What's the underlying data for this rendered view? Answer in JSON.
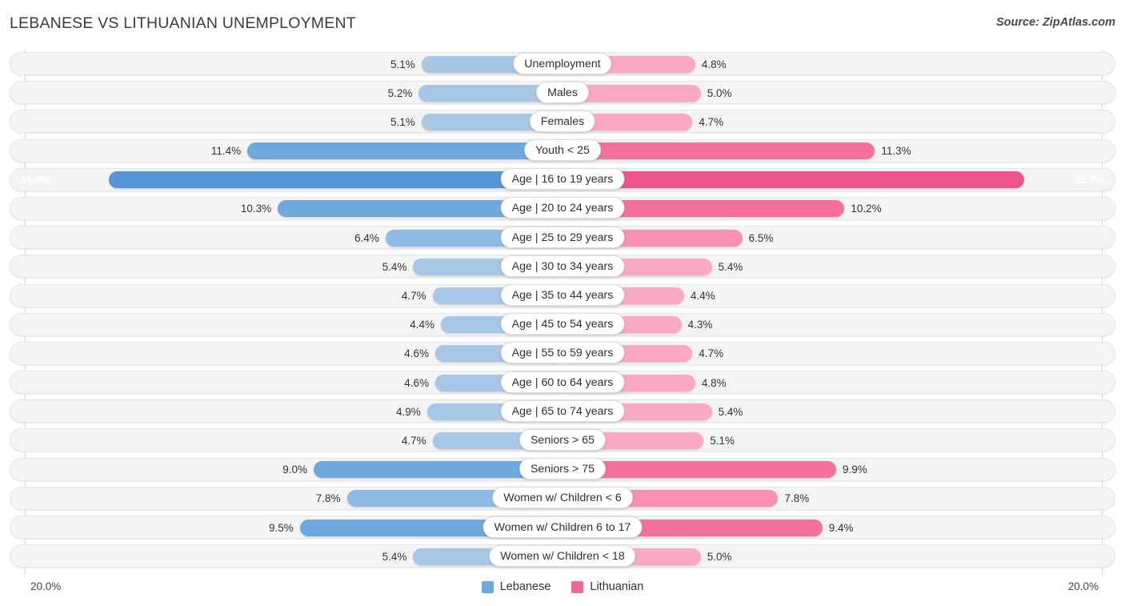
{
  "header": {
    "title": "LEBANESE VS LITHUANIAN UNEMPLOYMENT",
    "source": "Source: ZipAtlas.com"
  },
  "footer": {
    "axis_max_left": "20.0%",
    "axis_max_right": "20.0%"
  },
  "legend": {
    "items": [
      {
        "label": "Lebanese",
        "color": "#6fa8dc"
      },
      {
        "label": "Lithuanian",
        "color": "#f0679a"
      }
    ]
  },
  "colors": {
    "left_normal": "#a7c7e7",
    "left_mid": "#8fbae3",
    "left_strong": "#6fa8dc",
    "left_max": "#5596d8",
    "right_normal": "#fba8c5",
    "right_mid": "#f98fb5",
    "right_strong": "#f4719f",
    "right_max": "#f0538c",
    "track": "#f4f4f4",
    "axis": "#d8d8d8"
  },
  "chart_data": {
    "type": "bar",
    "subtype": "diverging-bidirectional-bar",
    "title": "LEBANESE VS LITHUANIAN UNEMPLOYMENT",
    "source": "Source: ZipAtlas.com",
    "xlabel": "",
    "ylabel": "",
    "xlim": [
      20.0,
      20.0
    ],
    "axis_max": 20.0,
    "unit": "%",
    "grid": false,
    "legend_position": "bottom-center",
    "categories": [
      "Unemployment",
      "Males",
      "Females",
      "Youth < 25",
      "Age | 16 to 19 years",
      "Age | 20 to 24 years",
      "Age | 25 to 29 years",
      "Age | 30 to 34 years",
      "Age | 35 to 44 years",
      "Age | 45 to 54 years",
      "Age | 55 to 59 years",
      "Age | 60 to 64 years",
      "Age | 65 to 74 years",
      "Seniors > 65",
      "Seniors > 75",
      "Women w/ Children < 6",
      "Women w/ Children 6 to 17",
      "Women w/ Children < 18"
    ],
    "series": [
      {
        "name": "Lebanese",
        "color": "#6fa8dc",
        "side": "left",
        "values": [
          5.1,
          5.2,
          5.1,
          11.4,
          16.4,
          10.3,
          6.4,
          5.4,
          4.7,
          4.4,
          4.6,
          4.6,
          4.9,
          4.7,
          9.0,
          7.8,
          9.5,
          5.4
        ]
      },
      {
        "name": "Lithuanian",
        "color": "#f0679a",
        "side": "right",
        "values": [
          4.8,
          5.0,
          4.7,
          11.3,
          16.7,
          10.2,
          6.5,
          5.4,
          4.4,
          4.3,
          4.7,
          4.8,
          5.4,
          5.1,
          9.9,
          7.8,
          9.4,
          5.0
        ]
      }
    ]
  },
  "rows": [
    {
      "label": "Unemployment",
      "left": "5.1%",
      "right": "4.8%",
      "lv": 5.1,
      "rv": 4.8,
      "lin": false,
      "rin": false
    },
    {
      "label": "Males",
      "left": "5.2%",
      "right": "5.0%",
      "lv": 5.2,
      "rv": 5.0,
      "lin": false,
      "rin": false
    },
    {
      "label": "Females",
      "left": "5.1%",
      "right": "4.7%",
      "lv": 5.1,
      "rv": 4.7,
      "lin": false,
      "rin": false
    },
    {
      "label": "Youth < 25",
      "left": "11.4%",
      "right": "11.3%",
      "lv": 11.4,
      "rv": 11.3,
      "lin": false,
      "rin": false
    },
    {
      "label": "Age | 16 to 19 years",
      "left": "16.4%",
      "right": "16.7%",
      "lv": 16.4,
      "rv": 16.7,
      "lin": true,
      "rin": true
    },
    {
      "label": "Age | 20 to 24 years",
      "left": "10.3%",
      "right": "10.2%",
      "lv": 10.3,
      "rv": 10.2,
      "lin": false,
      "rin": false
    },
    {
      "label": "Age | 25 to 29 years",
      "left": "6.4%",
      "right": "6.5%",
      "lv": 6.4,
      "rv": 6.5,
      "lin": false,
      "rin": false
    },
    {
      "label": "Age | 30 to 34 years",
      "left": "5.4%",
      "right": "5.4%",
      "lv": 5.4,
      "rv": 5.4,
      "lin": false,
      "rin": false
    },
    {
      "label": "Age | 35 to 44 years",
      "left": "4.7%",
      "right": "4.4%",
      "lv": 4.7,
      "rv": 4.4,
      "lin": false,
      "rin": false
    },
    {
      "label": "Age | 45 to 54 years",
      "left": "4.4%",
      "right": "4.3%",
      "lv": 4.4,
      "rv": 4.3,
      "lin": false,
      "rin": false
    },
    {
      "label": "Age | 55 to 59 years",
      "left": "4.6%",
      "right": "4.7%",
      "lv": 4.6,
      "rv": 4.7,
      "lin": false,
      "rin": false
    },
    {
      "label": "Age | 60 to 64 years",
      "left": "4.6%",
      "right": "4.8%",
      "lv": 4.6,
      "rv": 4.8,
      "lin": false,
      "rin": false
    },
    {
      "label": "Age | 65 to 74 years",
      "left": "4.9%",
      "right": "5.4%",
      "lv": 4.9,
      "rv": 5.4,
      "lin": false,
      "rin": false
    },
    {
      "label": "Seniors > 65",
      "left": "4.7%",
      "right": "5.1%",
      "lv": 4.7,
      "rv": 5.1,
      "lin": false,
      "rin": false
    },
    {
      "label": "Seniors > 75",
      "left": "9.0%",
      "right": "9.9%",
      "lv": 9.0,
      "rv": 9.9,
      "lin": false,
      "rin": false
    },
    {
      "label": "Women w/ Children < 6",
      "left": "7.8%",
      "right": "7.8%",
      "lv": 7.8,
      "rv": 7.8,
      "lin": false,
      "rin": false
    },
    {
      "label": "Women w/ Children 6 to 17",
      "left": "9.5%",
      "right": "9.4%",
      "lv": 9.5,
      "rv": 9.4,
      "lin": false,
      "rin": false
    },
    {
      "label": "Women w/ Children < 18",
      "left": "5.4%",
      "right": "5.0%",
      "lv": 5.4,
      "rv": 5.0,
      "lin": false,
      "rin": false
    }
  ]
}
